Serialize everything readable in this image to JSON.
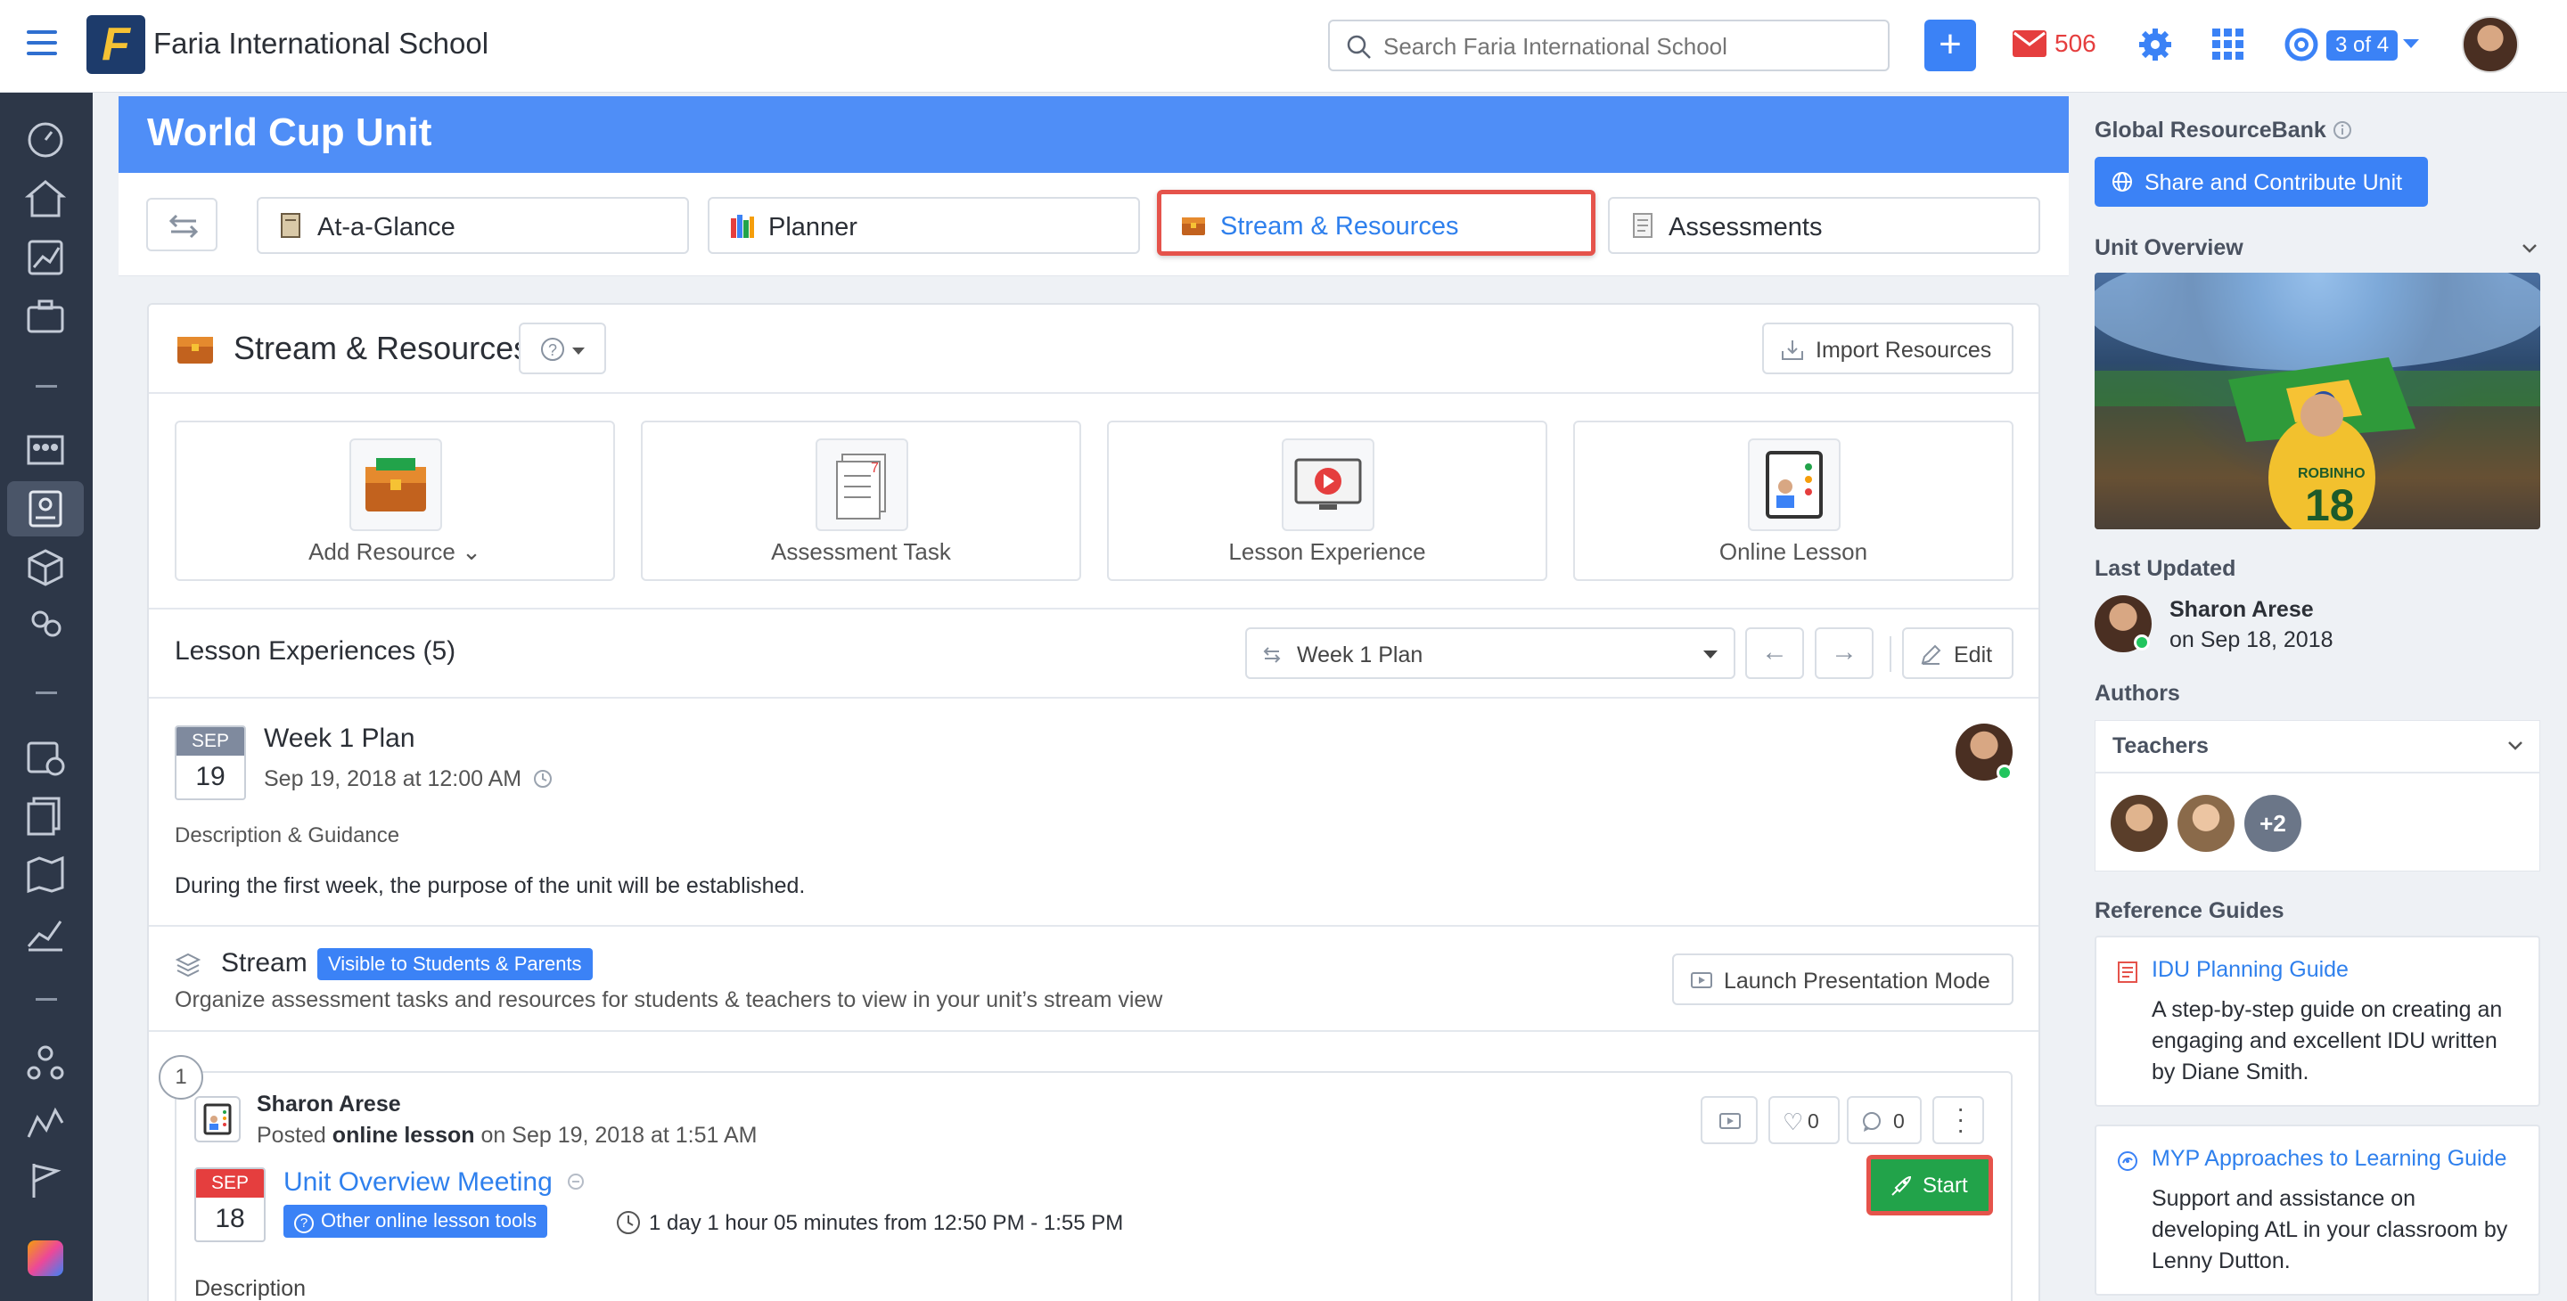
{
  "topbar": {
    "school_name": "Faria International School",
    "search_placeholder": "Search Faria International School",
    "mail_count": "506",
    "pager": "3 of 4",
    "logo_letter": "F"
  },
  "unit": {
    "title": "World Cup Unit",
    "tabs": [
      {
        "label": "At-a-Glance"
      },
      {
        "label": "Planner"
      },
      {
        "label": "Stream & Resources"
      },
      {
        "label": "Assessments"
      }
    ]
  },
  "stream_resources": {
    "title": "Stream & Resources",
    "import_label": "Import Resources",
    "cards": [
      {
        "label": "Add Resource"
      },
      {
        "label": "Assessment Task"
      },
      {
        "label": "Lesson Experience"
      },
      {
        "label": "Online Lesson"
      }
    ]
  },
  "lessons": {
    "heading": "Lesson Experiences (5)",
    "week_select": "Week 1 Plan",
    "edit_label": "Edit",
    "plan": {
      "month": "SEP",
      "day": "19",
      "title": "Week 1 Plan",
      "date": "Sep 19, 2018 at 12:00 AM",
      "desc_label": "Description & Guidance",
      "desc_text": "During the first week, the purpose of the unit will be established."
    }
  },
  "stream": {
    "title": "Stream",
    "visibility": "Visible to Students & Parents",
    "subtitle": "Organize assessment tasks and resources for students & teachers to view in your unit’s stream view",
    "launch_label": "Launch Presentation Mode"
  },
  "post": {
    "number": "1",
    "author": "Sharon Arese",
    "posted_prefix": "Posted",
    "posted_type": "online lesson",
    "posted_suffix": "on Sep 19, 2018 at 1:51 AM",
    "likes": "0",
    "comments": "0",
    "month": "SEP",
    "day": "18",
    "lesson_title": "Unit Overview Meeting",
    "tools_label": "Other online lesson tools",
    "duration": "1 day 1 hour 05 minutes from 12:50 PM - 1:55 PM",
    "start_label": "Start",
    "description_label": "Description"
  },
  "sidebar": {
    "global_label": "Global ResourceBank",
    "share_label": "Share and Contribute Unit",
    "overview_label": "Unit Overview",
    "last_updated_label": "Last Updated",
    "last_updated_name": "Sharon Arese",
    "last_updated_date": "on Sep 18, 2018",
    "authors_label": "Authors",
    "teachers_label": "Teachers",
    "more_count": "+2",
    "reference_label": "Reference Guides",
    "guides": [
      {
        "title": "IDU Planning Guide",
        "text": "A step-by-step guide on creating an engaging and excellent IDU written by Diane Smith."
      },
      {
        "title": "MYP Approaches to Learning Guide",
        "text": "Support and assistance on developing AtL in your classroom by Lenny Dutton."
      }
    ]
  },
  "colors": {
    "accent": "#3b82f6",
    "header_blue": "#4f8ef7",
    "highlight_red": "#e5534b",
    "start_green": "#22a34a",
    "rail": "#2d3748"
  }
}
